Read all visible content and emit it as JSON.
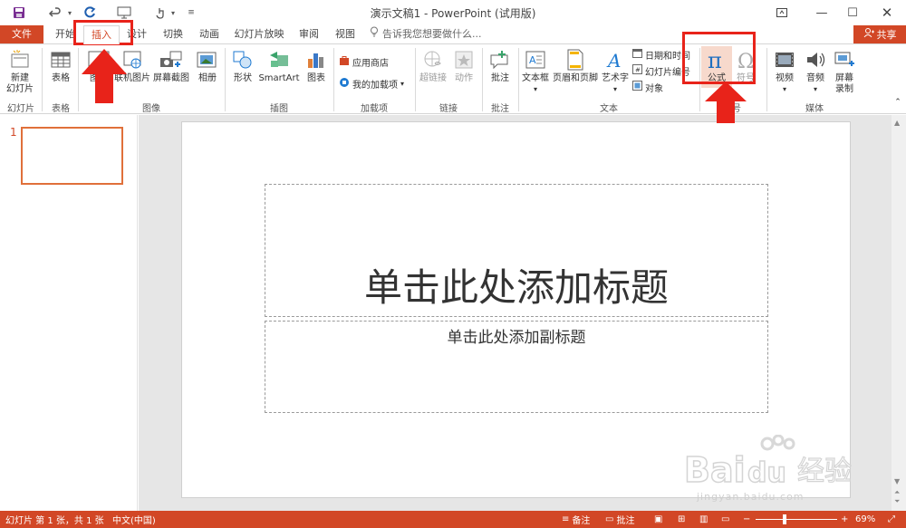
{
  "titlebar": {
    "doc_title": "演示文稿1 - PowerPoint (试用版)",
    "icons": [
      "save-icon",
      "undo-icon",
      "redo-icon",
      "present-icon",
      "touch-icon",
      "customize-icon"
    ],
    "window_buttons": [
      "ribbon-options-icon",
      "minimize-icon",
      "maximize-icon",
      "close-icon"
    ]
  },
  "tabs": {
    "file": "文件",
    "items": [
      "开始",
      "插入",
      "设计",
      "切换",
      "动画",
      "幻灯片放映",
      "审阅",
      "视图"
    ],
    "active": "插入",
    "tell_me": "告诉我您想要做什么...",
    "share": "共享"
  },
  "ribbon": {
    "slides": {
      "new_slide": "新建\n幻灯片",
      "group": "幻灯片"
    },
    "tables": {
      "table": "表格",
      "group": "表格"
    },
    "images": {
      "pictures": "图片",
      "online_pictures": "联机图片",
      "screenshot": "屏幕截图",
      "album": "相册",
      "group": "图像"
    },
    "illustrations": {
      "shapes": "形状",
      "smartart": "SmartArt",
      "chart": "图表",
      "group": "插图"
    },
    "addins": {
      "store": "应用商店",
      "my_addins": "我的加载项",
      "group": "加载项"
    },
    "links": {
      "hyperlink": "超链接",
      "action": "动作",
      "group": "链接"
    },
    "comments": {
      "comment": "批注",
      "group": "批注"
    },
    "text": {
      "textbox": "文本框",
      "header_footer": "页眉和页脚",
      "wordart": "艺术字",
      "date_time": "日期和时间",
      "slide_number": "幻灯片编号",
      "object": "对象",
      "group": "文本"
    },
    "symbols": {
      "equation": "公式",
      "symbol": "符号",
      "group": "符号"
    },
    "media": {
      "video": "视频",
      "audio": "音频",
      "screen_recording": "屏幕\n录制",
      "group": "媒体"
    }
  },
  "thumbnails": {
    "slide_number": "1"
  },
  "slide": {
    "title_placeholder": "单击此处添加标题",
    "subtitle_placeholder": "单击此处添加副标题"
  },
  "statusbar": {
    "slide_info": "幻灯片 第 1 张，共 1 张",
    "language": "中文(中国)",
    "notes": "备注",
    "comments": "批注",
    "zoom": "69%",
    "zoom_fraction": 0.69
  },
  "watermark": {
    "brand": "Baidu经验",
    "url": "jingyan.baidu.com"
  },
  "colors": {
    "accent": "#d24726",
    "annotation": "#e8231a",
    "equation_active": "#f7d9cc"
  }
}
